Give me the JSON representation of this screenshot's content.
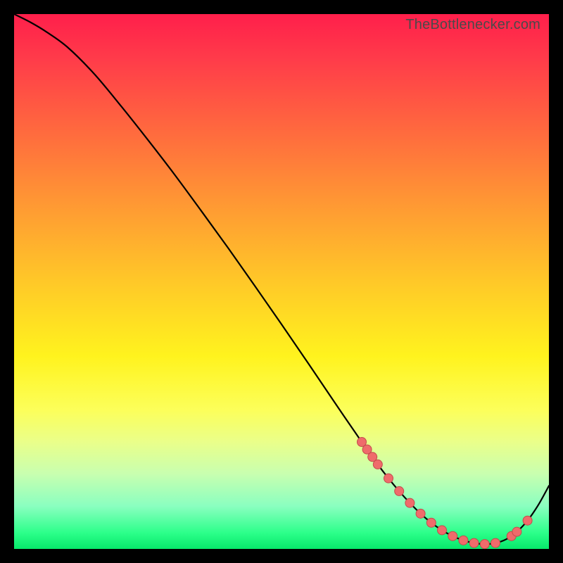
{
  "watermark": "TheBottlenecker.com",
  "colors": {
    "curve": "#000000",
    "marker_fill": "#ef6b6b",
    "marker_stroke": "#c44b4b"
  },
  "chart_data": {
    "type": "line",
    "title": "",
    "xlabel": "",
    "ylabel": "",
    "xlim": [
      0,
      100
    ],
    "ylim": [
      0,
      100
    ],
    "x": [
      0,
      3,
      6,
      10,
      15,
      20,
      25,
      30,
      35,
      40,
      45,
      50,
      55,
      60,
      65,
      68,
      70,
      72,
      74,
      76,
      78,
      80,
      82,
      84,
      86,
      88,
      90,
      92,
      94,
      96,
      98,
      100
    ],
    "y": [
      100,
      98.5,
      96.7,
      93.8,
      88.8,
      82.8,
      76.5,
      70.0,
      63.2,
      56.3,
      49.2,
      42.0,
      34.7,
      27.3,
      20.0,
      15.8,
      13.2,
      10.8,
      8.6,
      6.6,
      4.9,
      3.5,
      2.4,
      1.6,
      1.1,
      0.9,
      1.1,
      1.8,
      3.2,
      5.3,
      8.2,
      11.8
    ],
    "markers": {
      "x": [
        65,
        66,
        67,
        68,
        70,
        72,
        74,
        76,
        78,
        80,
        82,
        84,
        86,
        88,
        90,
        93,
        94,
        96
      ],
      "y": [
        20.0,
        18.6,
        17.2,
        15.8,
        13.2,
        10.8,
        8.6,
        6.6,
        4.9,
        3.5,
        2.4,
        1.6,
        1.1,
        0.9,
        1.1,
        2.4,
        3.2,
        5.3
      ]
    }
  }
}
